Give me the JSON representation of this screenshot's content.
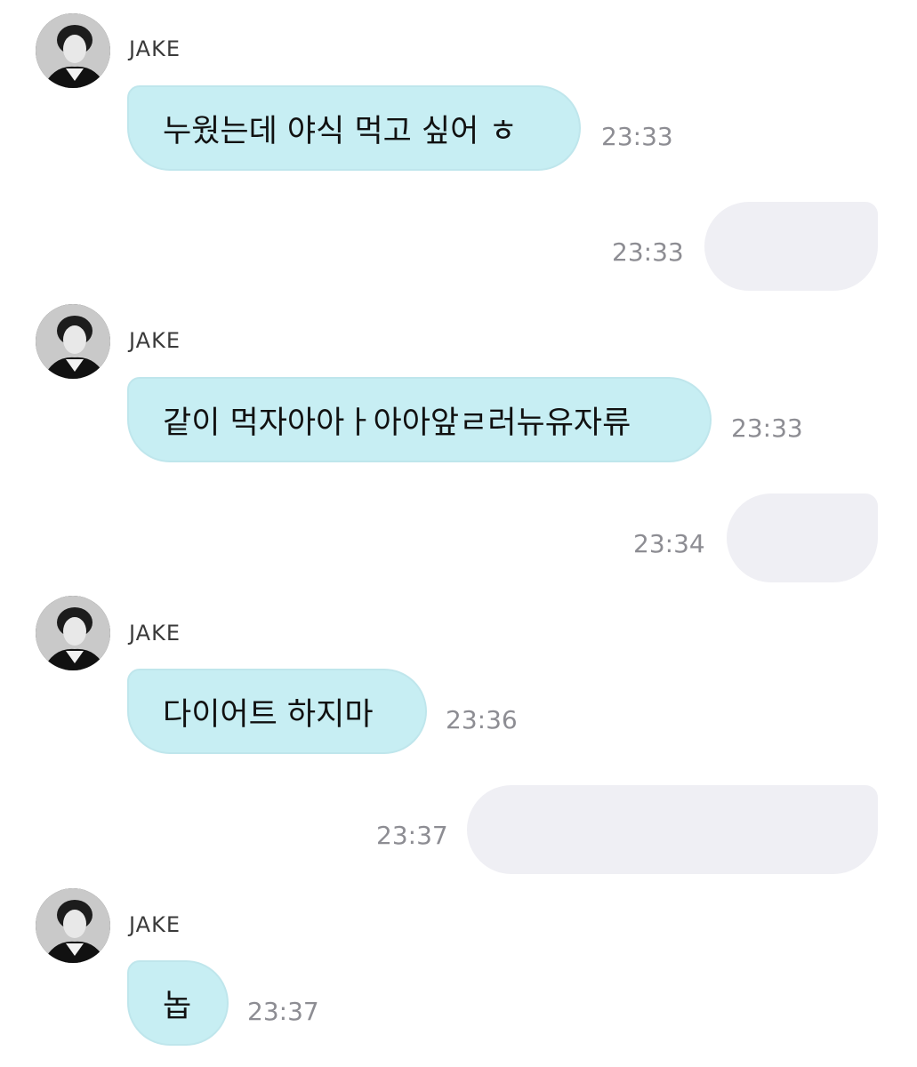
{
  "messages": [
    {
      "direction": "in",
      "sender": "JAKE",
      "text": "누웠는데 야식 먹고 싶어 ㅎ",
      "time": "23:33"
    },
    {
      "direction": "out",
      "text": "",
      "time": "23:33"
    },
    {
      "direction": "in",
      "sender": "JAKE",
      "text": "같이 먹자아아ㅏ아아앞ㄹ러뉴유자류",
      "time": "23:33"
    },
    {
      "direction": "out",
      "text": "",
      "time": "23:34"
    },
    {
      "direction": "in",
      "sender": "JAKE",
      "text": "다이어트 하지마",
      "time": "23:36"
    },
    {
      "direction": "out",
      "text": "",
      "time": "23:37"
    },
    {
      "direction": "in",
      "sender": "JAKE",
      "text": "놉",
      "time": "23:37"
    }
  ],
  "colors": {
    "incoming_bubble": "#c7eef3",
    "outgoing_bubble": "#efeff4",
    "timestamp": "#8d8d93"
  },
  "icons": {
    "avatar": "profile-avatar-icon"
  }
}
